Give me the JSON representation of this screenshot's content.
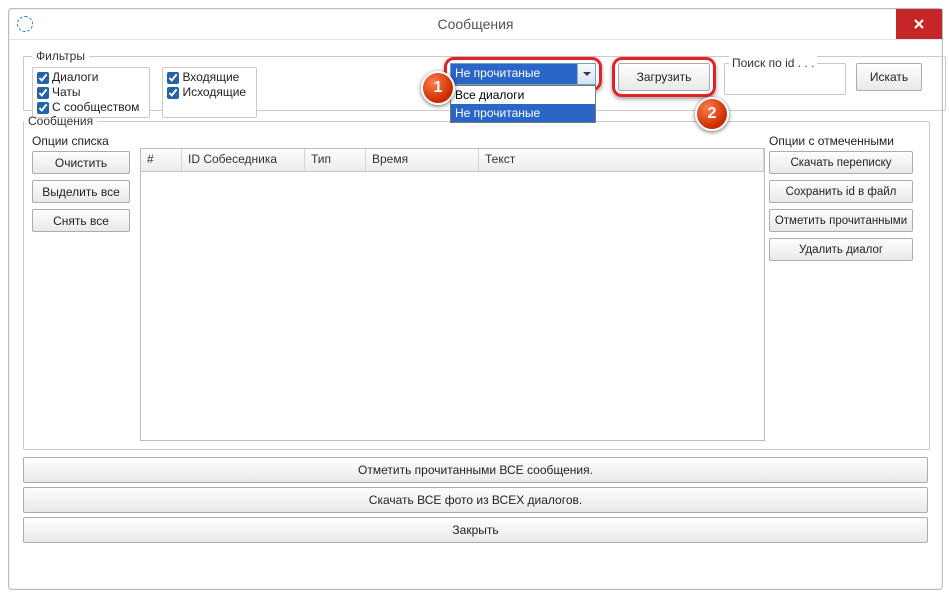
{
  "window": {
    "title": "Сообщения"
  },
  "filters": {
    "legend": "Фильтры",
    "col1": {
      "dialogs": "Диалоги",
      "chats": "Чаты",
      "community": "С сообществом"
    },
    "col2": {
      "incoming": "Входящие",
      "outgoing": "Исходящие"
    },
    "dropdown": {
      "selected": "Не прочитаные",
      "options": [
        "Все диалоги",
        "Не прочитаные"
      ]
    },
    "load_label": "Загрузить",
    "search_legend": "Поиск по id . . .",
    "search_value": "",
    "search_btn": "Искать"
  },
  "messages": {
    "legend": "Сообщения",
    "left_ops": {
      "label": "Опции списка",
      "clear": "Очистить",
      "select_all": "Выделить все",
      "deselect_all": "Снять все"
    },
    "right_ops": {
      "label": "Опции с отмеченными",
      "download": "Скачать переписку",
      "save_id": "Сохранить id в файл",
      "mark_read": "Отметить прочитанными",
      "delete": "Удалить диалог"
    },
    "columns": {
      "num": "#",
      "id": "ID Собеседника",
      "type": "Тип",
      "time": "Время",
      "text": "Текст"
    }
  },
  "bottom": {
    "mark_all": "Отметить прочитанными ВСЕ сообщения.",
    "download_photos": "Скачать ВСЕ фото из ВСЕХ диалогов.",
    "close": "Закрыть"
  },
  "steps": {
    "one": "1",
    "two": "2"
  }
}
